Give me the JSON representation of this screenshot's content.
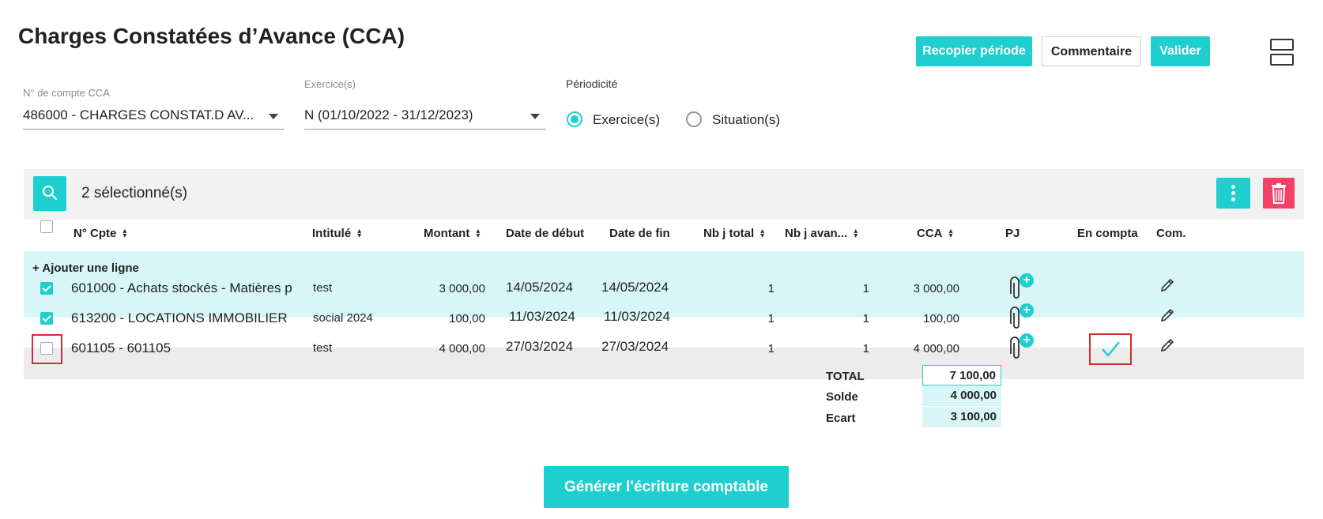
{
  "header": {
    "title": "Charges Constatées d’Avance (CCA)",
    "copy_period_label": "Recopier période",
    "comment_label": "Commentaire",
    "validate_label": "Valider"
  },
  "filters": {
    "account_label": "N° de compte CCA",
    "account_value": "486000 - CHARGES CONSTAT.D AV...",
    "exercise_label": "Exercice(s)",
    "exercise_value": "N (01/10/2022 - 31/12/2023)",
    "periodicity_label": "Périodicité",
    "periodicity_options": [
      "Exercice(s)",
      "Situation(s)"
    ],
    "periodicity_selected": "Exercice(s)"
  },
  "toolbar": {
    "selected_count": "2 sélectionné(s)"
  },
  "table": {
    "columns": [
      "N° Cpte",
      "Intitulé",
      "Montant",
      "Date de début",
      "Date de fin",
      "Nb j total",
      "Nb j avan...",
      "CCA",
      "PJ",
      "En compta",
      "Com."
    ],
    "add_line_label": "+ Ajouter une ligne",
    "rows": [
      {
        "account": "601000 - Achats stockés - Matières p",
        "label": "test",
        "amount": "3 000,00",
        "start": "14/05/2024",
        "end": "14/05/2024",
        "nb_total": "1",
        "nb_adv": "1",
        "cca": "3 000,00",
        "checked": true,
        "in_compta": false
      },
      {
        "account": "613200 - LOCATIONS IMMOBILIER",
        "label": "social 2024",
        "amount": "100,00",
        "start": "11/03/2024",
        "end": "11/03/2024",
        "nb_total": "1",
        "nb_adv": "1",
        "cca": "100,00",
        "checked": true,
        "in_compta": false
      },
      {
        "account": "601105 - 601105",
        "label": "test",
        "amount": "4 000,00",
        "start": "27/03/2024",
        "end": "27/03/2024",
        "nb_total": "1",
        "nb_adv": "1",
        "cca": "4 000,00",
        "checked": false,
        "in_compta": true
      }
    ]
  },
  "totals": {
    "total_label": "TOTAL",
    "total_value": "7 100,00",
    "solde_label": "Solde",
    "solde_value": "4 000,00",
    "ecart_label": "Ecart",
    "ecart_value": "3 100,00"
  },
  "footer": {
    "generate_label": "Générer l'écriture comptable"
  },
  "colors": {
    "accent": "#1fcfcf",
    "danger": "#f5406a",
    "highlight": "#d72a2a"
  }
}
